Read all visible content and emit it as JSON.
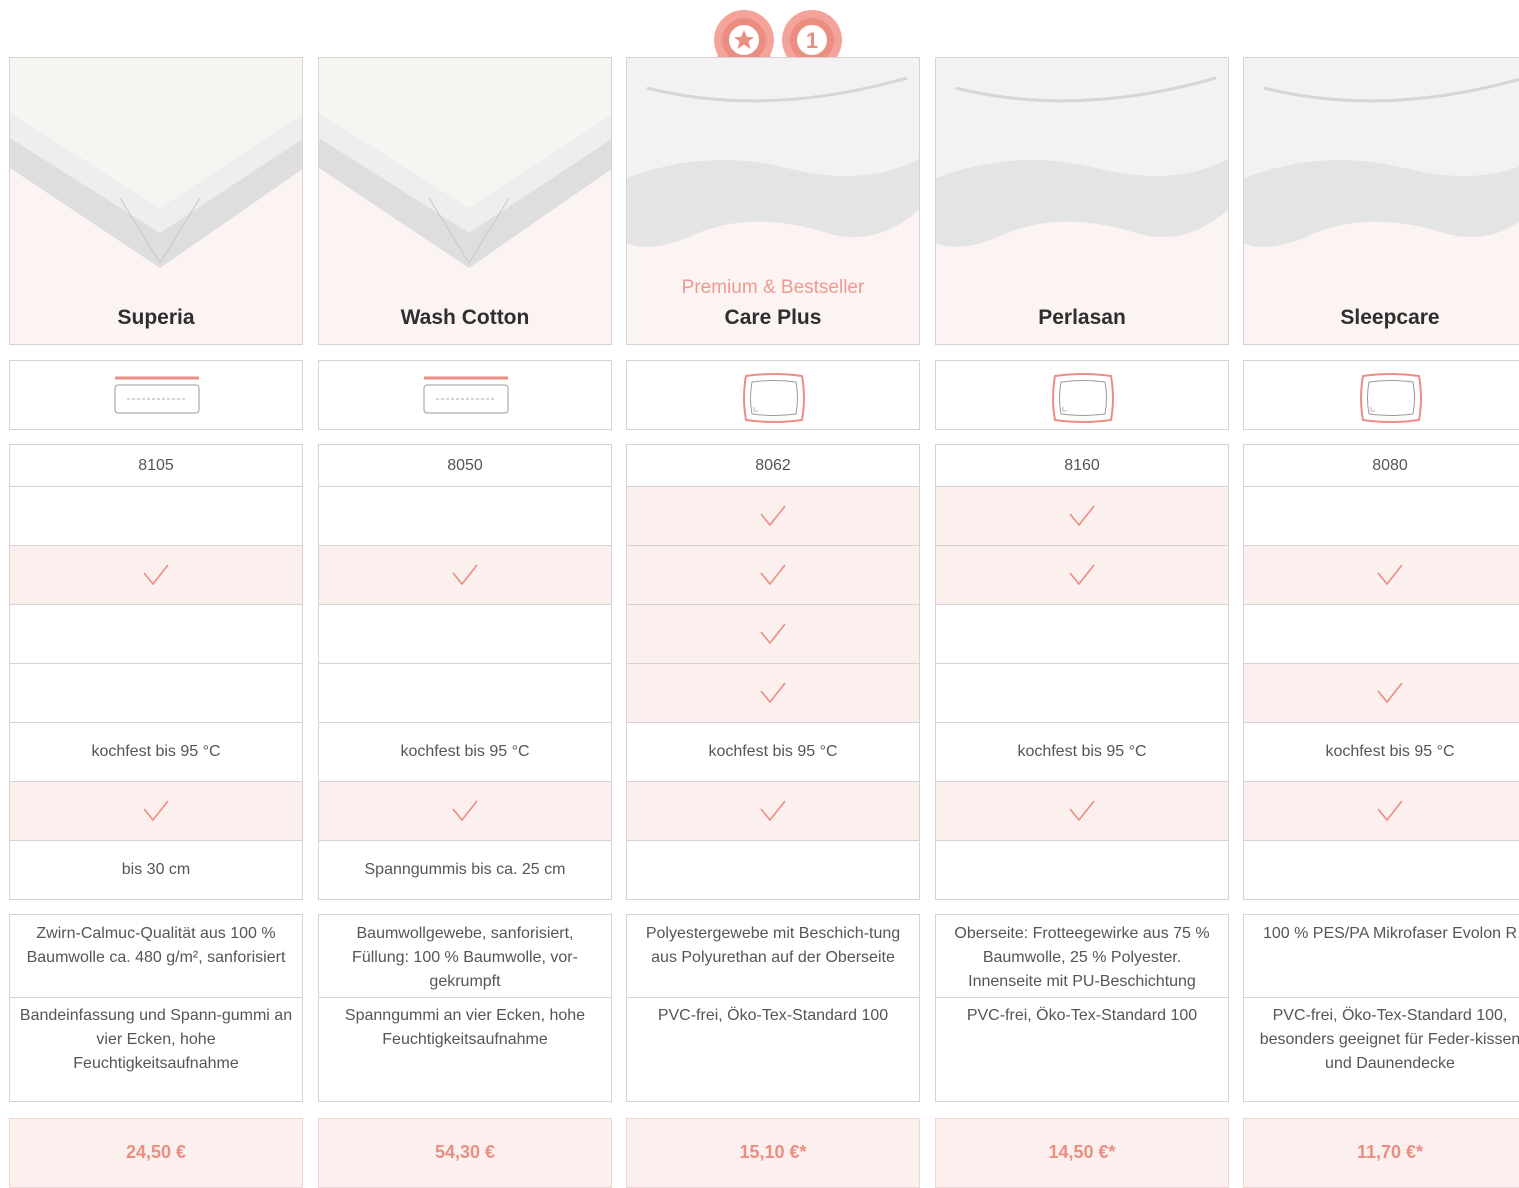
{
  "badges": {
    "left": "star-ribbon-badge",
    "right": "number-one-ribbon-badge",
    "rank_text": "1"
  },
  "colors": {
    "accent": "#ec8d82",
    "pink_bg": "#fcf0ee",
    "border": "#d8d2d0"
  },
  "products": [
    {
      "name": "Superia",
      "subtitle": "",
      "symbol": "mattress-topper",
      "article": "8105",
      "checks": [
        false,
        true,
        false,
        false
      ],
      "washing": "kochfest bis 95 °C",
      "check_row2": true,
      "fit": "bis 30 cm",
      "material": "Zwirn-Calmuc-Qualität aus 100 % Baumwolle ca. 480 g/m², sanforisiert",
      "features": "Bandeinfassung und Spann-gummi an vier Ecken, hohe Feuchtigkeitsaufnahme",
      "price": "24,50 €"
    },
    {
      "name": "Wash Cotton",
      "subtitle": "",
      "symbol": "mattress-topper",
      "article": "8050",
      "checks": [
        false,
        true,
        false,
        false
      ],
      "washing": "kochfest bis 95 °C",
      "check_row2": true,
      "fit": "Spanngummis bis ca. 25 cm",
      "material": "Baumwollgewebe, sanforisiert, Füllung: 100 % Baumwolle, vor-gekrumpft",
      "features": "Spanngummi an vier Ecken, hohe Feuchtigkeitsaufnahme",
      "price": "54,30 €"
    },
    {
      "name": "Care Plus",
      "subtitle": "Premium & Bestseller",
      "symbol": "pillow-cover",
      "article": "8062",
      "checks": [
        true,
        true,
        true,
        true
      ],
      "washing": "kochfest bis 95 °C",
      "check_row2": true,
      "fit": "",
      "material": "Polyestergewebe mit Beschich-tung aus Polyurethan auf der Oberseite",
      "features": "PVC-frei, Öko-Tex-Standard 100",
      "price": "15,10 €*"
    },
    {
      "name": "Perlasan",
      "subtitle": "",
      "symbol": "pillow-cover",
      "article": "8160",
      "checks": [
        true,
        true,
        false,
        false
      ],
      "washing": "kochfest bis 95 °C",
      "check_row2": true,
      "fit": "",
      "material": "Oberseite: Frotteegewirke aus 75 % Baumwolle, 25 % Polyester. Innenseite mit PU-Beschichtung",
      "features": "PVC-frei, Öko-Tex-Standard 100",
      "price": "14,50 €*"
    },
    {
      "name": "Sleepcare",
      "subtitle": "",
      "symbol": "pillow-cover",
      "article": "8080",
      "checks": [
        false,
        true,
        false,
        true
      ],
      "washing": "kochfest bis 95 °C",
      "check_row2": true,
      "fit": "",
      "material": "100 %  PES/PA Mikrofaser Evolon R",
      "features": "PVC-frei, Öko-Tex-Standard 100, besonders geeignet für Feder-kissen und Daunendecke",
      "price": "11,70 €*"
    }
  ]
}
